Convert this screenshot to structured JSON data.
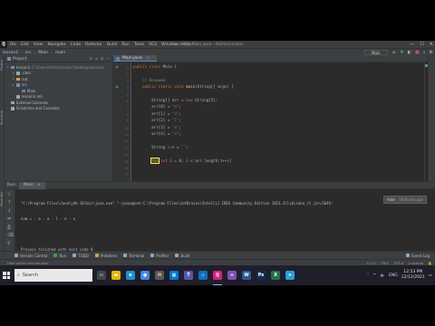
{
  "window": {
    "title": "lesson1 - Main.java - Administrator",
    "menu": [
      "File",
      "Edit",
      "View",
      "Navigate",
      "Code",
      "Refactor",
      "Build",
      "Run",
      "Tools",
      "VCS",
      "Window",
      "Help"
    ],
    "controls": [
      "—",
      "☐",
      "✕"
    ]
  },
  "navbar": {
    "crumbs": [
      "lesson1",
      "src",
      "Main",
      "main"
    ],
    "run_config": "Main"
  },
  "project_panel": {
    "title": "Project",
    "tree": [
      {
        "label": "lesson1",
        "dim": "C:\\Users\\Administrator\\Desktop\\lesson1",
        "color": "#6f8fb5",
        "indent": 0
      },
      {
        "label": ".idea",
        "dim": "",
        "color": "#9aa7b0",
        "indent": 1
      },
      {
        "label": "out",
        "dim": "",
        "color": "#d9a343",
        "indent": 1
      },
      {
        "label": "src",
        "dim": "",
        "color": "#6f8fb5",
        "indent": 1
      },
      {
        "label": "Main",
        "dim": "",
        "color": "#4a88c7",
        "indent": 2
      },
      {
        "label": "lesson1.iml",
        "dim": "",
        "color": "#9aa7b0",
        "indent": 1
      },
      {
        "label": "External Libraries",
        "dim": "",
        "color": "#9aa7b0",
        "indent": 0
      },
      {
        "label": "Scratches and Consoles",
        "dim": "",
        "color": "#9aa7b0",
        "indent": 0
      }
    ]
  },
  "editor": {
    "tab_label": "Main.java",
    "line_numbers": [
      "1",
      "2",
      "3",
      "4",
      "5",
      "6",
      "7",
      "8",
      "9",
      "10",
      "11",
      "12",
      "13",
      "14",
      "15",
      "16",
      "17",
      "18"
    ],
    "lines": [
      [
        {
          "t": "public class ",
          "c": "kw"
        },
        {
          "t": "Main {",
          "c": "tx"
        }
      ],
      [],
      [
        {
          "t": "    // Возьмём",
          "c": "cm"
        }
      ],
      [
        {
          "t": "    public static void ",
          "c": "kw"
        },
        {
          "t": "main",
          "c": "fn"
        },
        {
          "t": "(String[] args) {",
          "c": "tx"
        }
      ],
      [],
      [
        {
          "t": "        String[] arr = ",
          "c": "tx"
        },
        {
          "t": "new ",
          "c": "kw"
        },
        {
          "t": "String[5];",
          "c": "tx"
        }
      ],
      [
        {
          "t": "        arr[0] = ",
          "c": "tx"
        },
        {
          "t": "\"a\"",
          "c": "st"
        },
        {
          "t": ";",
          "c": "tx"
        }
      ],
      [
        {
          "t": "        arr[1] = ",
          "c": "tx"
        },
        {
          "t": "\"o\"",
          "c": "st"
        },
        {
          "t": ";",
          "c": "tx"
        }
      ],
      [
        {
          "t": "        arr[2] = ",
          "c": "tx"
        },
        {
          "t": "\"l\"",
          "c": "st"
        },
        {
          "t": ";",
          "c": "tx"
        }
      ],
      [
        {
          "t": "        arr[3] = ",
          "c": "tx"
        },
        {
          "t": "\"e\"",
          "c": "st"
        },
        {
          "t": ";",
          "c": "tx"
        }
      ],
      [
        {
          "t": "        arr[4] = ",
          "c": "tx"
        },
        {
          "t": "\"o\"",
          "c": "st"
        },
        {
          "t": ";",
          "c": "tx"
        }
      ],
      [],
      [
        {
          "t": "        String ",
          "c": "tx"
        },
        {
          "t": "sum",
          "c": "vr"
        },
        {
          "t": " = ",
          "c": "tx"
        },
        {
          "t": "\"\"",
          "c": "st"
        },
        {
          "t": ";",
          "c": "tx"
        }
      ],
      [],
      [
        {
          "t": "        ",
          "c": "tx"
        },
        {
          "t": "for",
          "c": "kw hl"
        },
        {
          "t": "(",
          "c": "tx"
        },
        {
          "t": "int ",
          "c": "kw"
        },
        {
          "t": "i = 0; i < arr.length;i++){",
          "c": "tx"
        }
      ]
    ]
  },
  "run_panel": {
    "label": "Run:",
    "tab": "Main",
    "console": [
      "\"C:\\Program Files\\Java\\jdk-16\\bin\\java.exe\" \"-javaagent:C:\\Program Files\\JetBrains\\IntelliJ IDEA Community Edition 2021.3\\lib\\idea_rt.jar=5649:",
      "sum = - a - a - l - e - o",
      "",
      "Process finished with exit code 0"
    ],
    "tooltip_label": "Hide",
    "tooltip_key": "Shift+Escape"
  },
  "bottom_tabs": [
    {
      "label": "Version Control",
      "color": "#9aa7b0"
    },
    {
      "label": "Run",
      "color": "#499c54"
    },
    {
      "label": "TODO",
      "color": "#9aa7b0"
    },
    {
      "label": "Problems",
      "color": "#d9a343"
    },
    {
      "label": "Terminal",
      "color": "#9aa7b0"
    },
    {
      "label": "Profiler",
      "color": "#9aa7b0"
    },
    {
      "label": "Build",
      "color": "#9aa7b0"
    }
  ],
  "event_log": "Event Log",
  "statusbar": {
    "message": "Hide active tool window",
    "right": [
      "11:22",
      "CRLF",
      "UTF-8",
      "4 spaces"
    ]
  },
  "taskbar": {
    "search_placeholder": "Search",
    "apps": [
      {
        "name": "Task View",
        "color": "#444",
        "glyph": "▭"
      },
      {
        "name": "File Explorer",
        "color": "#e8b600",
        "glyph": "▬"
      },
      {
        "name": "Edge",
        "color": "#1c8fd6",
        "glyph": "e"
      },
      {
        "name": "Chrome",
        "color": "#4285f4",
        "glyph": "●"
      },
      {
        "name": "Mail",
        "color": "#5a5a5a",
        "glyph": "✉"
      },
      {
        "name": "Store",
        "color": "#0078d4",
        "glyph": "▦"
      },
      {
        "name": "Teams",
        "color": "#5558af",
        "glyph": "T"
      },
      {
        "name": "VS Code",
        "color": "#0a6ec4",
        "glyph": "◇"
      },
      {
        "name": "IntelliJ IDEA",
        "color": "#d9207b",
        "glyph": "IJ"
      },
      {
        "name": "Visual Studio",
        "color": "#7b54b8",
        "glyph": "∞"
      },
      {
        "name": "Word",
        "color": "#2b579a",
        "glyph": "W"
      },
      {
        "name": "Photoshop",
        "color": "#0f2f4f",
        "glyph": "Ps"
      },
      {
        "name": "Excel",
        "color": "#217346",
        "glyph": "X"
      },
      {
        "name": "Telegram",
        "color": "#2aa0d8",
        "glyph": "➤"
      }
    ],
    "lang": "ENG",
    "time": "12:53 PM",
    "date": "12/12/2021"
  }
}
